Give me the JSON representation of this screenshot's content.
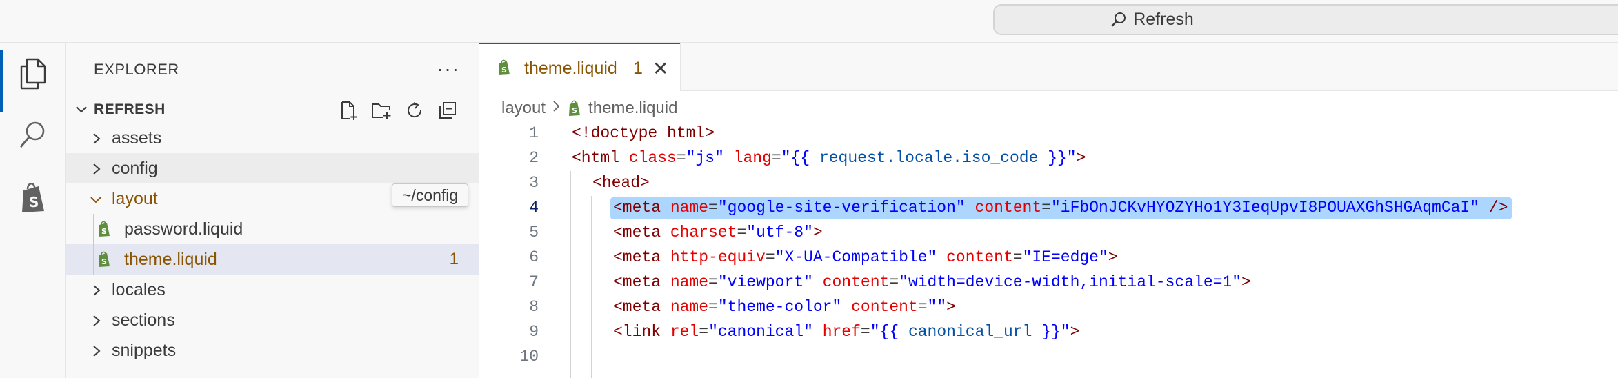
{
  "titlebar": {
    "search_label": "Refresh"
  },
  "activitybar": {
    "items": [
      "explorer-icon",
      "search-icon",
      "shopify-icon"
    ]
  },
  "sidebar": {
    "title": "EXPLORER",
    "more": "···",
    "section": "REFRESH",
    "tree": [
      {
        "name": "assets",
        "type": "folder",
        "expanded": false
      },
      {
        "name": "config",
        "type": "folder",
        "expanded": false
      },
      {
        "name": "layout",
        "type": "folder",
        "expanded": true
      },
      {
        "name": "password.liquid",
        "type": "file"
      },
      {
        "name": "theme.liquid",
        "type": "file",
        "badge": "1"
      },
      {
        "name": "locales",
        "type": "folder",
        "expanded": false
      },
      {
        "name": "sections",
        "type": "folder",
        "expanded": false
      },
      {
        "name": "snippets",
        "type": "folder",
        "expanded": false
      }
    ],
    "tooltip": "~/config"
  },
  "tabs": [
    {
      "name": "theme.liquid",
      "problems": "1"
    }
  ],
  "breadcrumb": {
    "folder": "layout",
    "file": "theme.liquid"
  },
  "editor": {
    "lines": [
      {
        "n": "1",
        "tokens": [
          [
            "tag",
            "<!doctype html>"
          ]
        ]
      },
      {
        "n": "2",
        "tokens": [
          [
            "tag",
            "<html "
          ],
          [
            "attr",
            "class"
          ],
          [
            "pun",
            "="
          ],
          [
            "str",
            "\"js\""
          ],
          [
            "pun",
            " "
          ],
          [
            "attr",
            "lang"
          ],
          [
            "pun",
            "="
          ],
          [
            "str",
            "\"{{ "
          ],
          [
            "liq",
            "request.locale.iso_code"
          ],
          [
            "str",
            " }}\""
          ],
          [
            "tag",
            ">"
          ]
        ]
      },
      {
        "n": "3",
        "tokens": [
          [
            "tag",
            "<head>"
          ]
        ]
      },
      {
        "n": "4",
        "tokens": [
          [
            "tag",
            "<meta "
          ],
          [
            "attr",
            "name"
          ],
          [
            "pun",
            "="
          ],
          [
            "str",
            "\"google-site-verification\""
          ],
          [
            "pun",
            " "
          ],
          [
            "attr",
            "content"
          ],
          [
            "pun",
            "="
          ],
          [
            "str",
            "\"iFbOnJCKvHYOZYHo1Y3IeqUpvI8POUAXGhSHGAqmCaI\""
          ],
          [
            "pun",
            " "
          ],
          [
            "tag",
            "/>"
          ]
        ]
      },
      {
        "n": "5",
        "tokens": [
          [
            "tag",
            "<meta "
          ],
          [
            "attr",
            "charset"
          ],
          [
            "pun",
            "="
          ],
          [
            "str",
            "\"utf-8\""
          ],
          [
            "tag",
            ">"
          ]
        ]
      },
      {
        "n": "6",
        "tokens": [
          [
            "tag",
            "<meta "
          ],
          [
            "attr",
            "http-equiv"
          ],
          [
            "pun",
            "="
          ],
          [
            "str",
            "\"X-UA-Compatible\""
          ],
          [
            "pun",
            " "
          ],
          [
            "attr",
            "content"
          ],
          [
            "pun",
            "="
          ],
          [
            "str",
            "\"IE=edge\""
          ],
          [
            "tag",
            ">"
          ]
        ]
      },
      {
        "n": "7",
        "tokens": [
          [
            "tag",
            "<meta "
          ],
          [
            "attr",
            "name"
          ],
          [
            "pun",
            "="
          ],
          [
            "str",
            "\"viewport\""
          ],
          [
            "pun",
            " "
          ],
          [
            "attr",
            "content"
          ],
          [
            "pun",
            "="
          ],
          [
            "str",
            "\"width=device-width,initial-scale=1\""
          ],
          [
            "tag",
            ">"
          ]
        ]
      },
      {
        "n": "8",
        "tokens": [
          [
            "tag",
            "<meta "
          ],
          [
            "attr",
            "name"
          ],
          [
            "pun",
            "="
          ],
          [
            "str",
            "\"theme-color\""
          ],
          [
            "pun",
            " "
          ],
          [
            "attr",
            "content"
          ],
          [
            "pun",
            "="
          ],
          [
            "str",
            "\"\""
          ],
          [
            "tag",
            ">"
          ]
        ]
      },
      {
        "n": "9",
        "tokens": [
          [
            "tag",
            "<link "
          ],
          [
            "attr",
            "rel"
          ],
          [
            "pun",
            "="
          ],
          [
            "str",
            "\"canonical\""
          ],
          [
            "pun",
            " "
          ],
          [
            "attr",
            "href"
          ],
          [
            "pun",
            "="
          ],
          [
            "str",
            "\"{{ "
          ],
          [
            "liq",
            "canonical_url"
          ],
          [
            "str",
            " }}\""
          ],
          [
            "tag",
            ">"
          ]
        ]
      },
      {
        "n": "10",
        "tokens": []
      }
    ],
    "current_line": "4"
  },
  "colors": {
    "accent": "#005fb8",
    "modified": "#895503",
    "shopify_green": "#5e8e3e",
    "selection": "#add6ff"
  }
}
